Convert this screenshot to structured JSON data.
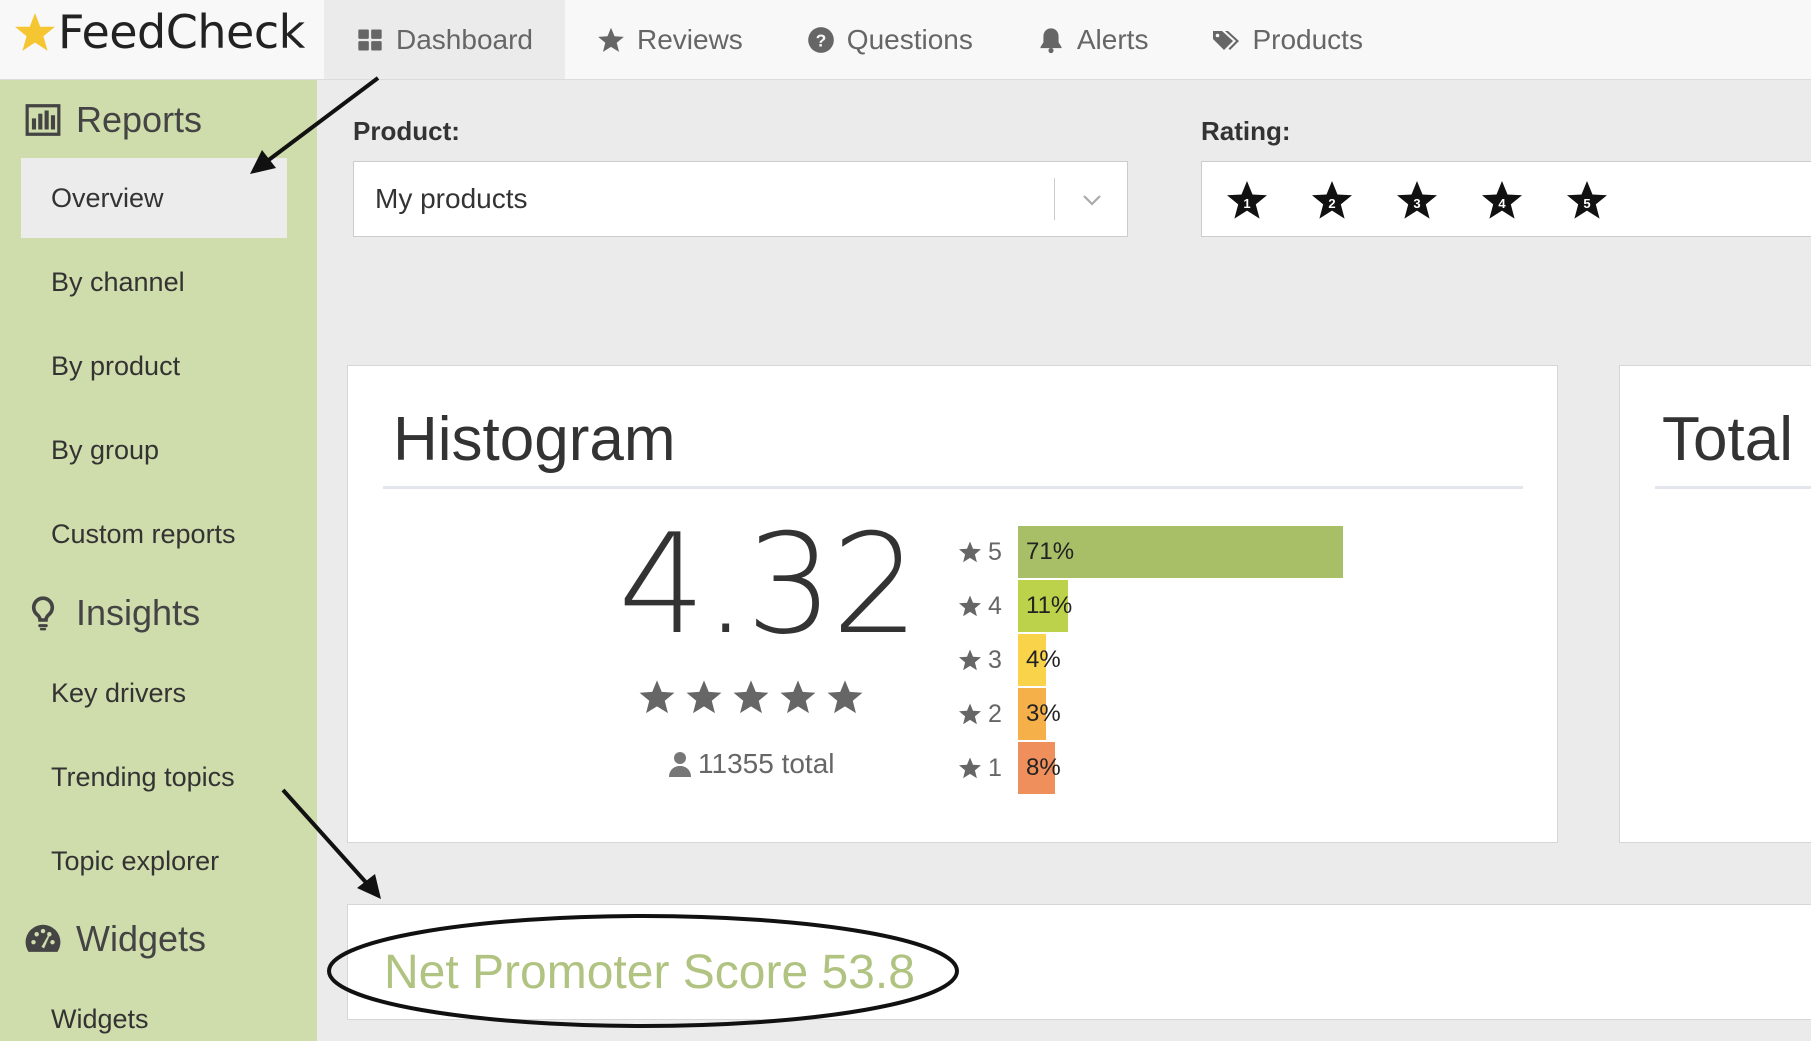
{
  "app": {
    "name": "FeedCheck"
  },
  "nav": [
    {
      "label": "Dashboard",
      "icon": "dashboard-icon"
    },
    {
      "label": "Reviews",
      "icon": "star-icon"
    },
    {
      "label": "Questions",
      "icon": "question-circle-icon"
    },
    {
      "label": "Alerts",
      "icon": "bell-icon"
    },
    {
      "label": "Products",
      "icon": "tags-icon"
    }
  ],
  "sidebar": {
    "reports": {
      "heading": "Reports",
      "icon": "bar-chart-icon"
    },
    "insights": {
      "heading": "Insights",
      "icon": "lightbulb-icon"
    },
    "widgets": {
      "heading": "Widgets",
      "icon": "dashboard-gauge-icon"
    },
    "items": [
      {
        "label": "Overview"
      },
      {
        "label": "By channel"
      },
      {
        "label": "By product"
      },
      {
        "label": "By group"
      },
      {
        "label": "Custom reports"
      },
      {
        "label": "Key drivers"
      },
      {
        "label": "Trending topics"
      },
      {
        "label": "Topic explorer"
      },
      {
        "label": "Widgets"
      }
    ]
  },
  "filters": {
    "product_label": "Product:",
    "product_value": "My products",
    "rating_label": "Rating:",
    "rating_options": [
      "1",
      "2",
      "3",
      "4",
      "5"
    ]
  },
  "histogram": {
    "title": "Histogram",
    "average": "4.32",
    "total_count": "11355 total",
    "stars_shown": 5
  },
  "chart_data": {
    "type": "bar",
    "orientation": "horizontal",
    "categories": [
      "5",
      "4",
      "3",
      "2",
      "1"
    ],
    "values": [
      71,
      11,
      4,
      3,
      8
    ],
    "value_labels": [
      "71%",
      "11%",
      "4%",
      "3%",
      "8%"
    ],
    "colors": [
      "#a8bf68",
      "#bcd24a",
      "#f9d44a",
      "#f5b04a",
      "#ef8f5b"
    ]
  },
  "total_card": {
    "title": "Total"
  },
  "nps": {
    "text": "Net Promoter Score 53.8",
    "color": "#b0c381"
  },
  "colors": {
    "sidebar": "#cfdcab",
    "accent_green": "#a8bf68"
  }
}
